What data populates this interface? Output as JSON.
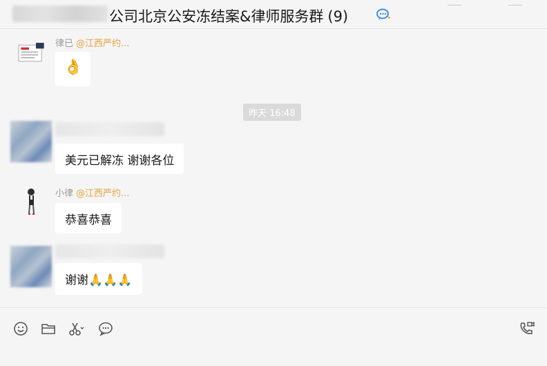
{
  "window": {
    "title": "公司北京公安冻结案&律师服务群",
    "member_count": "(9)",
    "title_icon": "chat-bubble-icon"
  },
  "messages": [
    {
      "sender": "律已",
      "sender_tag": "@江西严约...",
      "content": "👌",
      "avatar": "logo-avatar"
    },
    {
      "sender": "",
      "sender_tag": "",
      "content": "美元已解冻  谢谢各位",
      "avatar": "blurred-avatar"
    },
    {
      "sender": "小律",
      "sender_tag": "@江西严约...",
      "content": "恭喜恭喜",
      "avatar": "cartoon-lawyer-avatar"
    },
    {
      "sender": "",
      "sender_tag": "",
      "content": "谢谢🙏🙏🙏",
      "avatar": "blurred-avatar"
    }
  ],
  "timestamp": "昨天 16:48",
  "toolbar": {
    "icons": [
      "emoji-icon",
      "folder-icon",
      "scissors-icon",
      "chat-history-icon",
      "video-call-icon"
    ]
  }
}
